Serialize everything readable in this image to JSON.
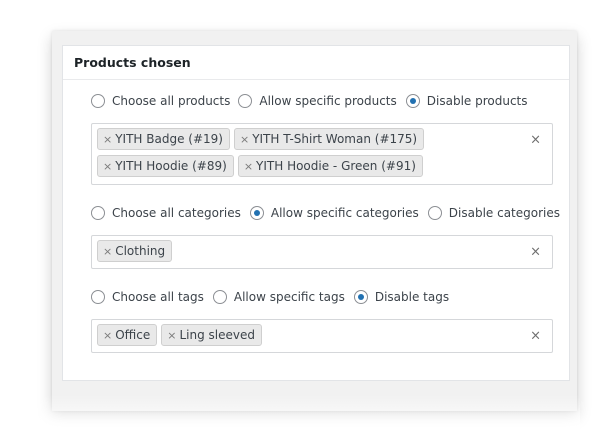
{
  "panel": {
    "title": "Products chosen"
  },
  "products": {
    "options": [
      {
        "label": "Choose all products",
        "checked": false
      },
      {
        "label": "Allow specific products",
        "checked": false
      },
      {
        "label": "Disable products",
        "checked": true
      }
    ],
    "tags": [
      "YITH Badge (#19)",
      "YITH T-Shirt Woman (#175)",
      "YITH Hoodie (#89)",
      "YITH Hoodie - Green (#91)"
    ]
  },
  "categories": {
    "options": [
      {
        "label": "Choose all categories",
        "checked": false
      },
      {
        "label": "Allow specific categories",
        "checked": true
      },
      {
        "label": "Disable categories",
        "checked": false
      }
    ],
    "tags": [
      "Clothing"
    ]
  },
  "tags_section": {
    "options": [
      {
        "label": "Choose all tags",
        "checked": false
      },
      {
        "label": "Allow specific tags",
        "checked": false
      },
      {
        "label": "Disable tags",
        "checked": true
      }
    ],
    "tags": [
      "Office",
      "Ling sleeved"
    ]
  },
  "icons": {
    "remove": "×",
    "clear": "×"
  },
  "colors": {
    "radio_checked": "#2271b1",
    "tag_bg": "#e9e9e9"
  }
}
